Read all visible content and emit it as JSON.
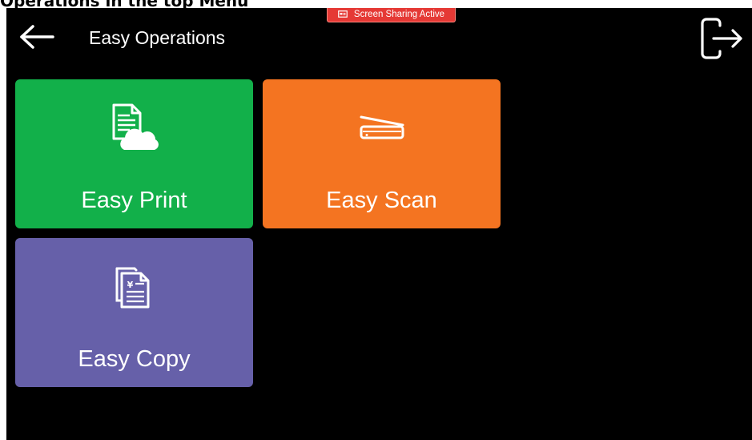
{
  "document": {
    "heading": "Operations in the top Menu"
  },
  "status": {
    "screen_sharing_label": "Screen Sharing Active",
    "screen_sharing_icon": "screen-share-icon"
  },
  "header": {
    "back_icon": "arrow-left-icon",
    "title": "Easy Operations",
    "logout_icon": "logout-icon"
  },
  "tiles": [
    {
      "label": "Easy Print",
      "icon": "print-document-cloud-icon",
      "color": "#12b04a"
    },
    {
      "label": "Easy Scan",
      "icon": "scanner-icon",
      "color": "#f47421"
    },
    {
      "label": "Easy Copy",
      "icon": "copy-documents-icon",
      "color": "#6660a9"
    }
  ],
  "colors": {
    "screen_background": "#000000",
    "text": "#ffffff",
    "badge": "#e53935"
  }
}
